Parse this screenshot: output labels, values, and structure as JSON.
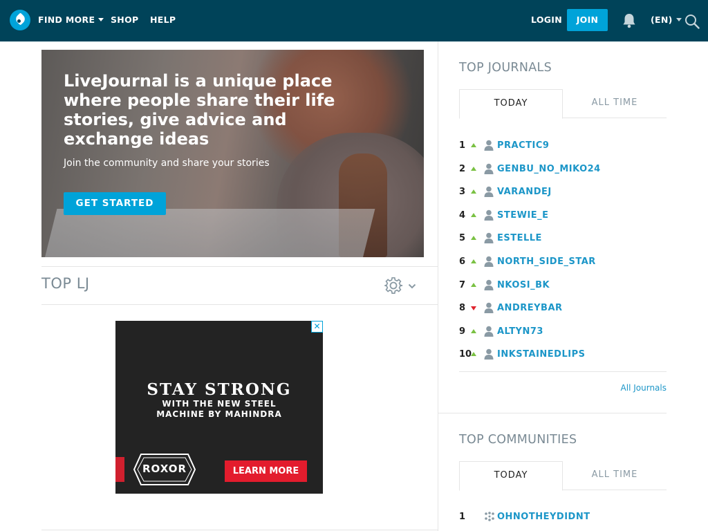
{
  "nav": {
    "find_more": "FIND MORE",
    "shop": "SHOP",
    "help": "HELP",
    "login": "LOGIN",
    "join": "JOIN",
    "language": "(EN)"
  },
  "hero": {
    "title": "LiveJournal is a unique place where people share their life stories, give advice and exchange ideas",
    "subtitle": "Join the community and share your stories",
    "button": "GET STARTED"
  },
  "top_lj": {
    "title": "TOP LJ"
  },
  "ad": {
    "close": "✕",
    "headline": "STAY STRONG",
    "sub": "WITH THE NEW STEEL MACHINE BY MAHINDRA",
    "logo_text": "ROXOR",
    "button": "LEARN MORE"
  },
  "top_journals": {
    "title": "TOP JOURNALS",
    "tabs": [
      "TODAY",
      "ALL TIME"
    ],
    "items": [
      {
        "rank": "1",
        "trend": "up",
        "name": "PRACTIC9"
      },
      {
        "rank": "2",
        "trend": "up",
        "name": "GENBU_NO_MIKO24"
      },
      {
        "rank": "3",
        "trend": "up",
        "name": "VARANDEJ"
      },
      {
        "rank": "4",
        "trend": "up",
        "name": "STEWIE_E"
      },
      {
        "rank": "5",
        "trend": "up",
        "name": "ESTELLE"
      },
      {
        "rank": "6",
        "trend": "up",
        "name": "NORTH_SIDE_STAR"
      },
      {
        "rank": "7",
        "trend": "up",
        "name": "NKOSI_BK"
      },
      {
        "rank": "8",
        "trend": "down",
        "name": "ANDREYBAR"
      },
      {
        "rank": "9",
        "trend": "up",
        "name": "ALTYN73"
      },
      {
        "rank": "10",
        "trend": "up",
        "name": "INKSTAINEDLIPS"
      }
    ],
    "all_link": "All Journals"
  },
  "top_communities": {
    "title": "TOP COMMUNITIES",
    "tabs": [
      "TODAY",
      "ALL TIME"
    ],
    "items": [
      {
        "rank": "1",
        "name": "OHNOTHEYDIDNT"
      }
    ]
  },
  "colors": {
    "header_bg": "#004359",
    "accent": "#00a3d9",
    "link": "#1c96c8",
    "trend_up": "#7ac143",
    "trend_down": "#e0242e"
  },
  "icons": [
    "logo-icon",
    "bell-icon",
    "search-icon",
    "gear-icon",
    "chevron-down-icon",
    "user-icon",
    "community-icon"
  ]
}
